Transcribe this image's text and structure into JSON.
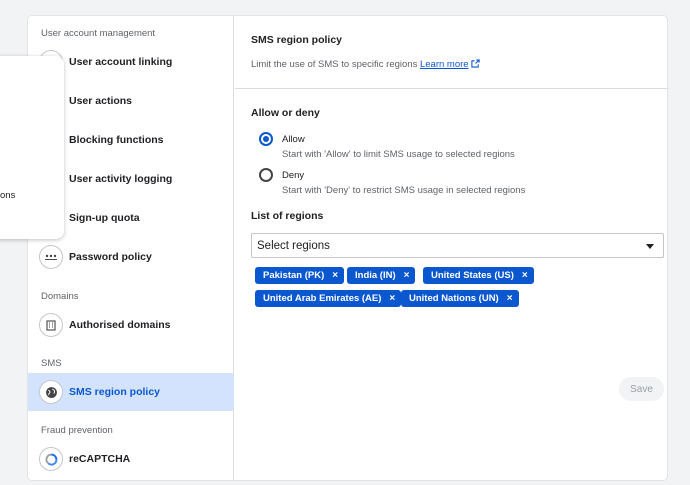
{
  "sidebar": {
    "sections": [
      {
        "label": "User account management"
      },
      {
        "label": "Domains"
      },
      {
        "label": "SMS"
      },
      {
        "label": "Fraud prevention"
      }
    ],
    "items": [
      {
        "label": "User account linking",
        "icon": "link-icon"
      },
      {
        "label": "User actions",
        "icon": "person-icon"
      },
      {
        "label": "Blocking functions",
        "icon": "block-icon"
      },
      {
        "label": "User activity logging",
        "icon": "log-icon"
      },
      {
        "label": "Sign-up quota",
        "icon": "quota-icon"
      },
      {
        "label": "Password policy",
        "icon": "password-icon"
      },
      {
        "label": "Authorised domains",
        "icon": "building-icon"
      },
      {
        "label": "SMS region policy",
        "icon": "globe-icon",
        "active": true
      },
      {
        "label": "reCAPTCHA",
        "icon": "recaptcha-icon"
      }
    ]
  },
  "popup": {
    "fragment": "ons"
  },
  "main": {
    "title": "SMS region policy",
    "description": "Limit the use of SMS to specific regions",
    "learn_more": "Learn more",
    "allow_deny_heading": "Allow or deny",
    "options": [
      {
        "label": "Allow",
        "help": "Start with 'Allow' to limit SMS usage to selected regions",
        "selected": true
      },
      {
        "label": "Deny",
        "help": "Start with 'Deny' to restrict SMS usage in selected regions",
        "selected": false
      }
    ],
    "regions_heading": "List of regions",
    "select_placeholder": "Select regions",
    "chips": [
      "Pakistan (PK)",
      "India (IN)",
      "United States (US)",
      "United Arab Emirates (AE)",
      "United Nations (UN)"
    ],
    "chip_remove": "×",
    "save_label": "Save"
  },
  "colors": {
    "accent": "#0b57d0",
    "active_bg": "#d3e3fd"
  }
}
